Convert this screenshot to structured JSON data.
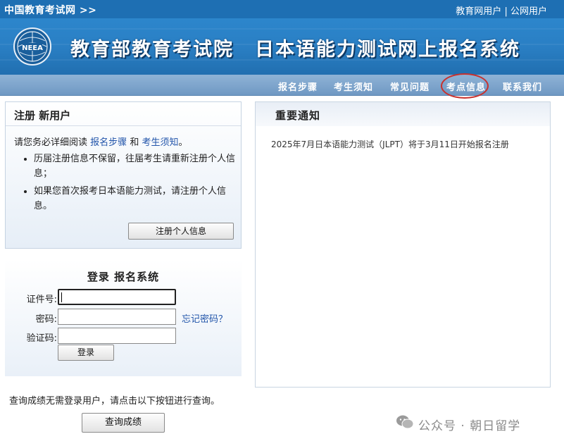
{
  "topbar": {
    "site_name": "中国教育考试网 >>",
    "link_edu_user": "教育网用户",
    "link_divider": "|",
    "link_public_user": "公网用户"
  },
  "header": {
    "org_name": "教育部教育考试院",
    "system_name": "日本语能力测试网上报名系统",
    "logo_text": "NEEA"
  },
  "nav": {
    "items": [
      {
        "label": "报名步骤"
      },
      {
        "label": "考生须知"
      },
      {
        "label": "常见问题"
      },
      {
        "label": "考点信息"
      },
      {
        "label": "联系我们"
      }
    ],
    "highlight_color": "#c9302c"
  },
  "register": {
    "title": "注册 新用户",
    "intro_prefix": "请您务必详细阅读",
    "intro_link1": "报名步骤",
    "intro_and": "和",
    "intro_link2": "考生须知",
    "intro_suffix": "。",
    "bullets": [
      "历届注册信息不保留，往届考生请重新注册个人信息；",
      "如果您首次报考日本语能力测试，请注册个人信息。"
    ],
    "button_label": "注册个人信息"
  },
  "login": {
    "title": "登录 报名系统",
    "id_label": "证件号:",
    "password_label": "密码:",
    "captcha_label": "验证码:",
    "forgot_label": "忘记密码？",
    "button_label": "登录"
  },
  "score": {
    "text": "查询成绩无需登录用户，请点击以下按钮进行查询。",
    "button_label": "查询成绩"
  },
  "notice": {
    "title": "重要通知",
    "items": [
      "2025年7月日本语能力测试（JLPT）将于3月11日开始报名注册"
    ]
  },
  "watermark": {
    "text": "公众号 · 朝日留学"
  },
  "colors": {
    "topbar": "#1e6fb3",
    "banner": "#2a7fc4",
    "navbar": "#7aa3cc",
    "link": "#2255aa"
  }
}
